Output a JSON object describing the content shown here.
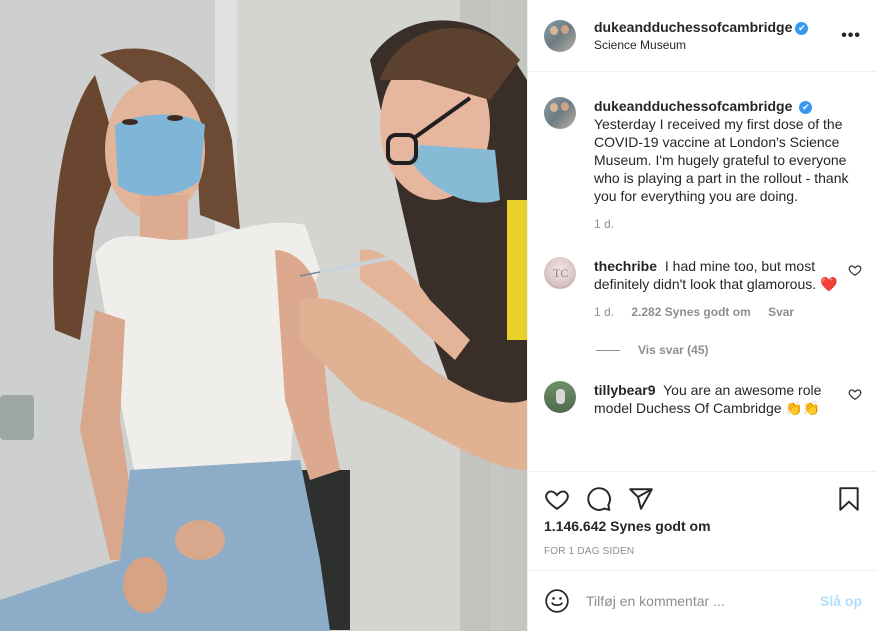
{
  "post": {
    "username": "dukeandduchessofcambridge",
    "location": "Science Museum",
    "verified_mark": "✔",
    "more_label": "•••"
  },
  "caption": {
    "username": "dukeandduchessofcambridge",
    "text": "Yesterday I received my first dose of the COVID-19 vaccine at London's Science Museum. I'm hugely grateful to everyone who is playing a part in the rollout - thank you for everything you are doing.",
    "age": "1 d."
  },
  "comments": [
    {
      "username": "thechribe",
      "text": "I had mine too, but most definitely didn't look that glamorous.",
      "emoji": "❤️",
      "age": "1 d.",
      "likes": "2.282 Synes godt om",
      "reply_label": "Svar",
      "view_replies": "Vis svar (45)"
    },
    {
      "username": "tillybear9",
      "text": "You are an awesome role model Duchess Of Cambridge",
      "emoji": "👏👏"
    }
  ],
  "actions": {
    "icons": [
      "heart-icon",
      "comment-icon",
      "share-icon",
      "bookmark-icon"
    ],
    "likes": "1.146.642 Synes godt om",
    "time_ago": "FOR 1 DAG SIDEN"
  },
  "add_comment": {
    "placeholder": "Tilføj en kommentar ...",
    "post_label": "Slå op"
  },
  "colors": {
    "verified": "#3897f0",
    "post_button_disabled": "#b2dffc",
    "secondary_text": "#8e8e8e",
    "emoji_heart": "#e0245e"
  }
}
